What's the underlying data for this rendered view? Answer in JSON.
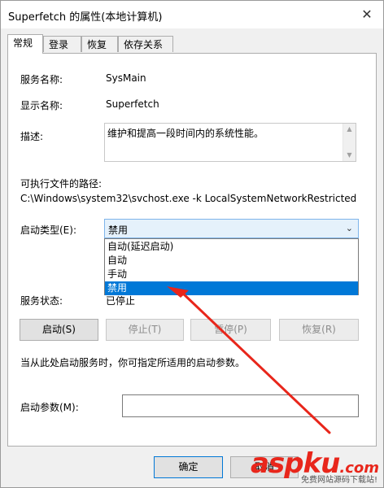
{
  "window": {
    "title": "Superfetch 的属性(本地计算机)",
    "close_glyph": "✕"
  },
  "tabs": [
    {
      "label": "常规",
      "active": true
    },
    {
      "label": "登录",
      "active": false
    },
    {
      "label": "恢复",
      "active": false
    },
    {
      "label": "依存关系",
      "active": false
    }
  ],
  "general": {
    "service_name_label": "服务名称:",
    "service_name_value": "SysMain",
    "display_name_label": "显示名称:",
    "display_name_value": "Superfetch",
    "description_label": "描述:",
    "description_value": "维护和提高一段时间内的系统性能。",
    "exe_path_label": "可执行文件的路径:",
    "exe_path_value": "C:\\Windows\\system32\\svchost.exe -k LocalSystemNetworkRestricted",
    "startup_type_label": "启动类型(E):",
    "startup_type_value": "禁用",
    "startup_options": [
      "自动(延迟启动)",
      "自动",
      "手动",
      "禁用"
    ],
    "selected_option": "禁用",
    "status_label": "服务状态:",
    "status_value": "已停止",
    "buttons": {
      "start": "启动(S)",
      "stop": "停止(T)",
      "pause": "暂停(P)",
      "resume": "恢复(R)"
    },
    "hint": "当从此处启动服务时，你可指定所适用的启动参数。",
    "start_params_label": "启动参数(M):",
    "start_params_value": ""
  },
  "footer": {
    "ok": "确定",
    "cancel": "取消"
  },
  "watermark": {
    "main": "aspku",
    "dot": ".com",
    "sub": "免费网站源码下载站!"
  },
  "colors": {
    "accent": "#0078d7",
    "arrow": "#e8261b"
  }
}
